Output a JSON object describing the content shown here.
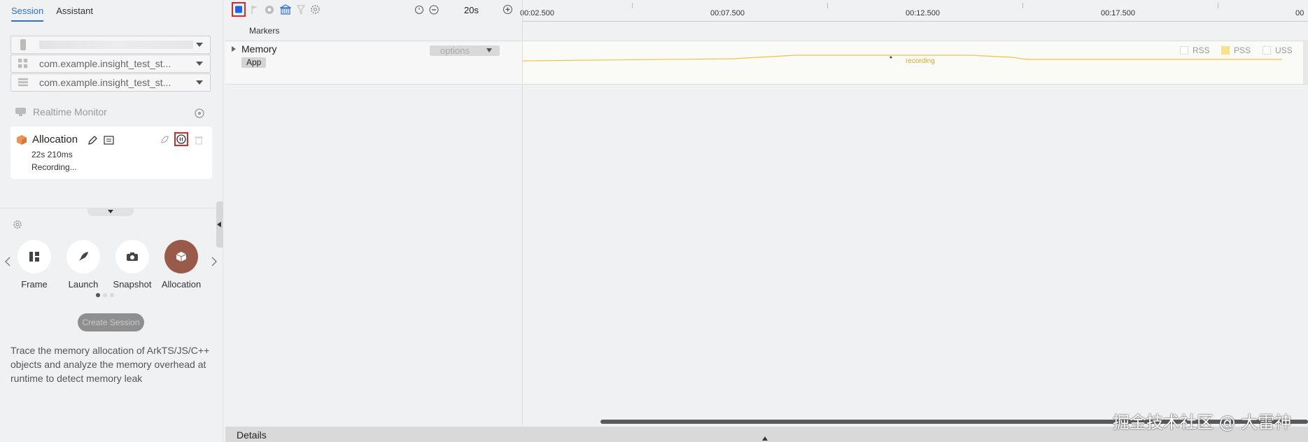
{
  "tabs": [
    {
      "label": "Session",
      "active": true
    },
    {
      "label": "Assistant",
      "active": false
    }
  ],
  "device_selects": [
    {
      "icon": "phone-icon",
      "value": ""
    },
    {
      "icon": "app-grid-icon",
      "value": "com.example.insight_test_st..."
    },
    {
      "icon": "process-icon",
      "value": "com.example.insight_test_st..."
    }
  ],
  "realtime_monitor": {
    "label": "Realtime Monitor"
  },
  "session_card": {
    "title": "Allocation",
    "duration": "22s 210ms",
    "status": "Recording..."
  },
  "tools": [
    {
      "label": "Frame",
      "icon": "frame-icon",
      "active": false
    },
    {
      "label": "Launch",
      "icon": "rocket-icon",
      "active": false
    },
    {
      "label": "Snapshot",
      "icon": "camera-icon",
      "active": false
    },
    {
      "label": "Allocation",
      "icon": "cube-icon",
      "active": true
    }
  ],
  "create_session": "Create Session",
  "description": "Trace the memory allocation of ArkTS/JS/C++ objects and analyze the memory overhead at runtime to detect memory leak",
  "toolbar": {
    "zoom_value": "20s"
  },
  "ruler_ticks": [
    "00:02.500",
    "00:07.500",
    "00:12.500",
    "00:17.500",
    "00"
  ],
  "markers_label": "Markers",
  "memory_track": {
    "title": "Memory",
    "badge": "App",
    "options_label": "options",
    "recording_label": "recording",
    "legend": [
      {
        "label": "RSS",
        "checked": false,
        "color": "#ffffff"
      },
      {
        "label": "PSS",
        "checked": true,
        "color": "#f5e28a"
      },
      {
        "label": "USS",
        "checked": false,
        "color": "#ffffff"
      }
    ],
    "line_color": "#f0c24a"
  },
  "details_label": "Details",
  "watermark": "掘金技术社区 @ 大雷神"
}
